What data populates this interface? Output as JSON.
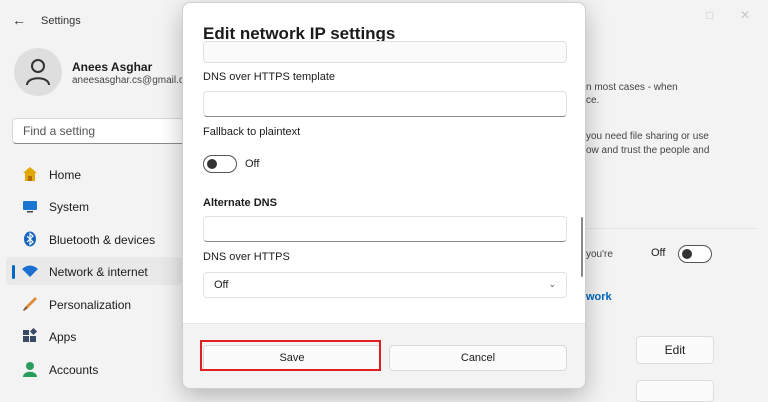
{
  "window": {
    "app_title": "Settings"
  },
  "profile": {
    "name": "Anees Asghar",
    "email": "aneesasghar.cs@gmail.com"
  },
  "search": {
    "placeholder": "Find a setting"
  },
  "nav": {
    "items": [
      {
        "label": "Home",
        "icon": "home-icon",
        "active": false
      },
      {
        "label": "System",
        "icon": "system-icon",
        "active": false
      },
      {
        "label": "Bluetooth & devices",
        "icon": "bluetooth-icon",
        "active": false
      },
      {
        "label": "Network & internet",
        "icon": "wifi-icon",
        "active": true
      },
      {
        "label": "Personalization",
        "icon": "brush-icon",
        "active": false
      },
      {
        "label": "Apps",
        "icon": "apps-icon",
        "active": false
      },
      {
        "label": "Accounts",
        "icon": "accounts-icon",
        "active": false
      }
    ]
  },
  "background": {
    "text1": "n most cases - when",
    "text2": "ce.",
    "text3": "you need file sharing or use",
    "text4": "ow and trust the people and",
    "text5": "you're",
    "toggle_label": "Off",
    "link": "work",
    "edit_label": "Edit"
  },
  "dialog": {
    "title": "Edit network IP settings",
    "doh_template_label": "DNS over HTTPS template",
    "doh_template_value": "",
    "fallback_label": "Fallback to plaintext",
    "fallback_toggle": "Off",
    "alternate_dns_heading": "Alternate DNS",
    "alternate_dns_value": "",
    "doh_label": "DNS over HTTPS",
    "doh_selected": "Off",
    "save_label": "Save",
    "cancel_label": "Cancel"
  },
  "colors": {
    "accent": "#0067c0",
    "highlight": "#e02020"
  }
}
